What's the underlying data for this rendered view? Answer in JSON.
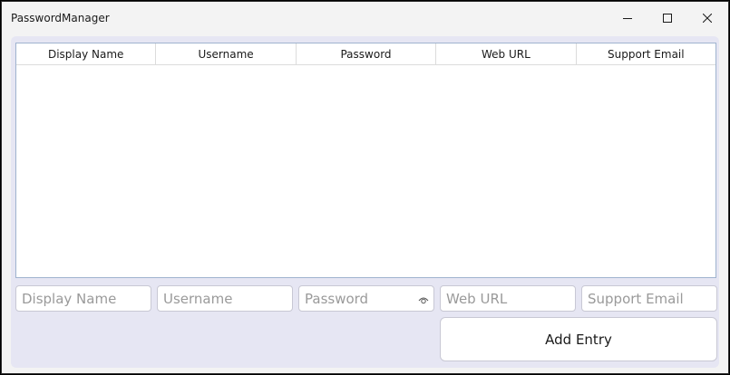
{
  "window": {
    "title": "PasswordManager",
    "controls": {
      "minimize": "minimize-icon",
      "maximize": "maximize-icon",
      "close": "close-icon"
    }
  },
  "table": {
    "columns": [
      "Display Name",
      "Username",
      "Password",
      "Web URL",
      "Support Email"
    ],
    "rows": []
  },
  "form": {
    "display_name": {
      "value": "",
      "placeholder": "Display Name"
    },
    "username": {
      "value": "",
      "placeholder": "Username"
    },
    "password": {
      "value": "",
      "placeholder": "Password",
      "reveal_icon": "eye-icon"
    },
    "web_url": {
      "value": "",
      "placeholder": "Web URL"
    },
    "support_email": {
      "value": "",
      "placeholder": "Support Email"
    },
    "add_label": "Add Entry"
  },
  "colors": {
    "content_bg": "#e6e6f3",
    "table_border": "#9fb3cf",
    "window_bg": "#f3f3f3"
  }
}
